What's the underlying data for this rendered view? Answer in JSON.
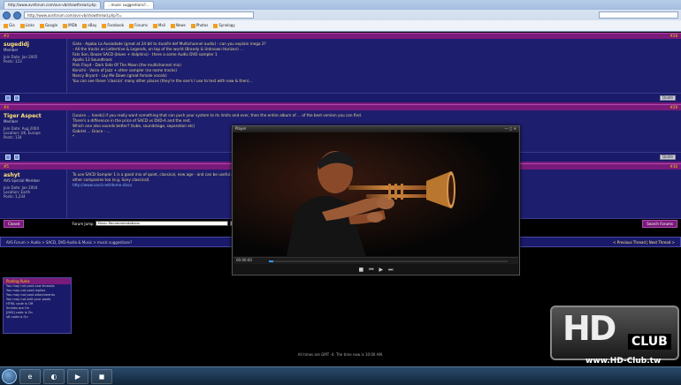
{
  "browser": {
    "tabs": [
      "http://www.avsforum.com/avs-vb/showthread.php",
      "...music suggestions?..."
    ],
    "url": "http://www.avsforum.com/avs-vb/showthread.php?t=",
    "bookmarks": [
      "Gia",
      "Links",
      "Google",
      "IMDb",
      "eBay",
      "Facebook",
      "Forums",
      "Mail",
      "News",
      "Photos",
      "Synology"
    ]
  },
  "posts": [
    {
      "header_left": "#3",
      "header_right": "#28",
      "user": "sugedidj",
      "rank": "Member",
      "meta": [
        "Join Date: Jan 2005",
        "Posts: 123"
      ],
      "lines": [
        "Gato - Aqaba La Avaiadade (great at 24-bit to dual/hi-def Multichannel audio) - can you explain mega 2?",
        "- All the tracks on Letterhive & Legends, on top of the world (Brandy & Unknown Horizon) ...",
        "Fats Son, Booze SACD (blues + dolphins) - there a some Audio DVD sampler 1",
        "Apollo 13 Soundtrack",
        "Pink Floyd - Dark Side Of The Moon (the multichannel mix)",
        "Kenichi - Voice of Jazz + other sampler (no name tracks)",
        "Nancy Bryant - Lay Me Down (great female vocals)",
        "",
        "You can see these 'classics' many other places (they're the one's I use to test with now & then)..."
      ],
      "foot_right": "Quote"
    },
    {
      "header_left": "#4",
      "header_right": "#29",
      "user": "Tiger Aspect",
      "rank": "Member",
      "meta": [
        "Join Date: Aug 2004",
        "Location: UK, Europe",
        "Posts: 134"
      ],
      "lines": [
        "[Louise ... hands] if you really want something that can push your system to its limits and over, then the entire album of ... of the best version you can find.",
        "",
        "There's a difference in the price of SACD vs DVD-A and the rest.",
        "Which one also sounds better? (tube, soundstage, separation etc)",
        "  Gabriel ...  Grace - ... ",
        "",
        "   *"
      ],
      "foot_right": "Quote"
    },
    {
      "header_left": "#5",
      "header_right": "#30",
      "user": "ashyt",
      "rank": "AVS Special Member",
      "meta": [
        "Join Date: Jan 2004",
        "Location: Earth",
        "Posts: 1,234"
      ],
      "lines": [
        "To use SACD Sampler 1 is a good mix of quiet, classical, new age - and can be useful at back has some good bass tasting stuff. They have a bunch of",
        "other companies too (e.g. Sony classical).",
        "",
        "http://www.sacd.net/demo-discs"
      ],
      "foot_right": "Quote"
    }
  ],
  "toolbar": {
    "reply_label": "Closed",
    "quickjump_label": "Forum Jump",
    "quickjump_value": "Music Recommendations",
    "go_label": "Go",
    "search_label": "Search Forums"
  },
  "nav": {
    "breadcrumb": "AVS Forum > Audio > SACD, DVD-Audio & Music > music suggestions?",
    "prev_next": "< Previous Thread | Next Thread >"
  },
  "rules": {
    "title": "Posting Rules",
    "lines": [
      "You may not post new threads",
      "You may not post replies",
      "You may not post attachments",
      "You may not edit your posts",
      "",
      "HTML code is Off",
      "Smilies are On",
      "[IMG] code is On",
      "vB code is On"
    ]
  },
  "footer": "All times are GMT -4. The time now is 10:00 AM.",
  "player": {
    "title": "Player",
    "time": "00:00:00",
    "progress": 0.02
  },
  "watermark": {
    "hd": "HD",
    "club": "CLUB",
    "url": "www.HD-Club.tw"
  },
  "taskbar": {
    "items": [
      "e",
      "◐",
      "▶",
      "◼"
    ]
  }
}
